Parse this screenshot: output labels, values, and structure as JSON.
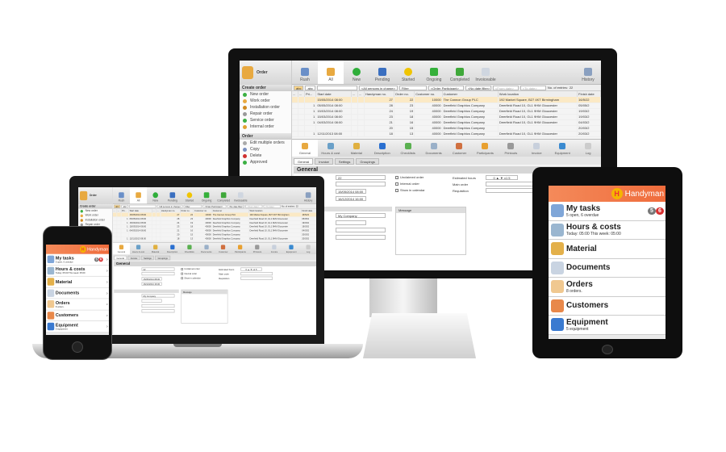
{
  "desktop_app": {
    "module_title": "Order",
    "toolbar": [
      {
        "label": "Rush",
        "color": "#6a8fc8"
      },
      {
        "label": "All",
        "color": "#e8a940",
        "active": true
      },
      {
        "label": "New",
        "color": "#2fae3a"
      },
      {
        "label": "Pending",
        "color": "#3a6fc0"
      },
      {
        "label": "Started",
        "color": "#f0c400"
      },
      {
        "label": "Ongoing",
        "color": "#35b03a"
      },
      {
        "label": "Completed",
        "color": "#3fa83a"
      },
      {
        "label": "Invoiceable",
        "color": "#cfd6e0"
      }
    ],
    "history_label": "History",
    "sidebar": {
      "create_section": "Create order",
      "create_items": [
        {
          "label": "New order",
          "color": "#3cb043"
        },
        {
          "label": "Work order",
          "color": "#e8a940"
        },
        {
          "label": "Installation order",
          "color": "#d08a20"
        },
        {
          "label": "Repair order",
          "color": "#999999"
        },
        {
          "label": "Service order",
          "color": "#3cb043"
        },
        {
          "label": "Internal order",
          "color": "#e0a030"
        }
      ],
      "order_section": "Order",
      "order_items": [
        {
          "label": "Edit multiple orders",
          "color": "#aaaaaa"
        },
        {
          "label": "Copy",
          "color": "#7a8fc0"
        },
        {
          "label": "Delete",
          "color": "#d03030"
        },
        {
          "label": "Approved",
          "color": "#3cb043"
        }
      ]
    },
    "filter": {
      "tag1": "abc",
      "tag2": "abc",
      "search_value": "",
      "persons": "<All persons in charge>",
      "filter": "Filter",
      "participant": "<Order Participant>",
      "date_filter": "<No date filter>",
      "from_date": "<From date>",
      "to_date": "<To date>",
      "entries_label": "No. of entries:",
      "entries_count": "22"
    },
    "columns": [
      "...",
      "...",
      "Pri...",
      "Start date",
      "...",
      "...",
      "Handyman no.",
      "Order no.",
      "Customer no.",
      "Customer",
      "Work location",
      "Finish date"
    ],
    "rows": [
      [
        "",
        "",
        "",
        "15/05/2014 08:00",
        "",
        "",
        "27",
        "22",
        "10000",
        "The Cannon Group PLC",
        "192 Market Square, B27 4KT Birmingham",
        "16/5/22"
      ],
      [
        "",
        "",
        "1",
        "05/05/2014 08:00",
        "",
        "",
        "28",
        "23",
        "40000",
        "Deerfield Graphics Company",
        "Deerfield Road 10, GL1 9HM Gloucester",
        "05/05/2"
      ],
      [
        "",
        "",
        "1",
        "15/03/2014 08:00",
        "",
        "",
        "24",
        "19",
        "40000",
        "Deerfield Graphics Company",
        "Deerfield Road 10, GL1 9HM Gloucester",
        "19/03/2"
      ],
      [
        "",
        "",
        "1",
        "15/03/2014 08:00",
        "",
        "",
        "23",
        "18",
        "40000",
        "Deerfield Graphics Company",
        "Deerfield Road 10, GL1 9HM Gloucester",
        "19/03/2"
      ],
      [
        "",
        "",
        "1",
        "04/03/2014 08:00",
        "",
        "",
        "21",
        "16",
        "40000",
        "Deerfield Graphics Company",
        "Deerfield Road 10, GL1 9HM Gloucester",
        "04/03/2"
      ],
      [
        "",
        "",
        "",
        "",
        "",
        "",
        "20",
        "15",
        "40000",
        "Deerfield Graphics Company",
        "",
        "20/03/2"
      ],
      [
        "",
        "",
        "1",
        "12/11/2013 08:00",
        "",
        "",
        "18",
        "13",
        "40000",
        "Deerfield Graphics Company",
        "Deerfield Road 10, GL1 9HM Gloucester",
        "20/03/2"
      ]
    ],
    "detail_tabs": [
      "General",
      "Hours & cost",
      "Material",
      "Description",
      "Checklists",
      "Documents",
      "Customer",
      "Participants",
      "Printouts",
      "Invoice",
      "Equipment"
    ],
    "log_label": "Log",
    "sub_tabs": [
      "General",
      "Invoice",
      "Settings",
      "Groupings"
    ],
    "form": {
      "section": "General",
      "order_no": "22",
      "field2": "",
      "start": "15/05/2014 08:00",
      "end": "16/12/2014 16:00",
      "unclaimed": "Unclaimed order",
      "internal": "Internal order",
      "calendar": "Show in calendar",
      "est_hours_label": "Estimated hours",
      "est_hours_value": "0 ▲ ▼ x1 5",
      "main_order_label": "Main order",
      "requisition_label": "Requisition",
      "company": "My Company",
      "message_label": "Message"
    }
  },
  "mobile_app": {
    "brand": "Handyman",
    "items": [
      {
        "title": "My tasks",
        "subtitle": "5 open, 6 overdue",
        "badge_open": "5",
        "badge_overdue": "6",
        "color": "#7fa6d8"
      },
      {
        "title": "Hours & costs",
        "subtitle": "Today: 05:00 This week: 05:00",
        "color": "#9ab6d0"
      },
      {
        "title": "Material",
        "subtitle": "",
        "color": "#e3b04a"
      },
      {
        "title": "Documents",
        "subtitle": "",
        "color": "#c9d4e2"
      },
      {
        "title": "Orders",
        "subtitle": "8 orders.",
        "color": "#f0c890"
      },
      {
        "title": "Customers",
        "subtitle": "",
        "color": "#e8884a"
      },
      {
        "title": "Equipment",
        "subtitle": "5 equipment",
        "color": "#3a7ad0"
      }
    ],
    "badge_colors": {
      "open": "#777777",
      "overdue": "#d83030"
    }
  }
}
